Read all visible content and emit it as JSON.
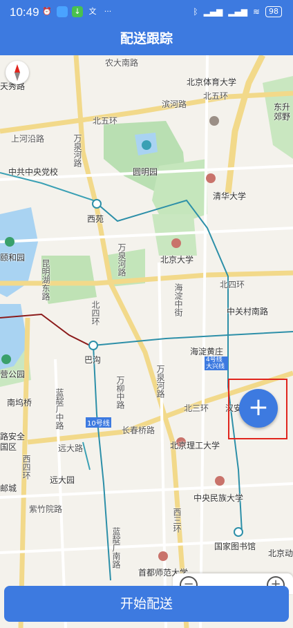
{
  "status": {
    "time": "10:49",
    "battery": "98"
  },
  "header": {
    "title": "配送跟踪"
  },
  "map": {
    "labels": [
      {
        "text": "农大南路"
      },
      {
        "text": "天秀路"
      },
      {
        "text": "北京体育大学"
      },
      {
        "text": "东升"
      },
      {
        "text": "郊野"
      },
      {
        "text": "滨河路"
      },
      {
        "text": "北五环"
      },
      {
        "text": "北五环"
      },
      {
        "text": "上河沿路"
      },
      {
        "text": "万泉河路"
      },
      {
        "text": "中共中央党校"
      },
      {
        "text": "圆明园"
      },
      {
        "text": "清华大学"
      },
      {
        "text": "西苑"
      },
      {
        "text": "颐和园"
      },
      {
        "text": "北京大学"
      },
      {
        "text": "万泉河路"
      },
      {
        "text": "昆明湖东路"
      },
      {
        "text": "海淀中街"
      },
      {
        "text": "北四环"
      },
      {
        "text": "中关村南路"
      },
      {
        "text": "北四环"
      },
      {
        "text": "巴沟"
      },
      {
        "text": "海淀黄庄"
      },
      {
        "text": "4号线 大兴线"
      },
      {
        "text": "营公园"
      },
      {
        "text": "万柳中路"
      },
      {
        "text": "万泉河路"
      },
      {
        "text": "南坞桥"
      },
      {
        "text": "蓝靛厂中路"
      },
      {
        "text": "北三环"
      },
      {
        "text": "汉安"
      },
      {
        "text": "10号线"
      },
      {
        "text": "长春桥路"
      },
      {
        "text": "路安全"
      },
      {
        "text": "国区"
      },
      {
        "text": "远大路"
      },
      {
        "text": "北京理工大学"
      },
      {
        "text": "西四环"
      },
      {
        "text": "远大园"
      },
      {
        "text": "邮城"
      },
      {
        "text": "中央民族大学"
      },
      {
        "text": "紫竹院路"
      },
      {
        "text": "西三环"
      },
      {
        "text": "蓝靛厂南路"
      },
      {
        "text": "国家图书馆"
      },
      {
        "text": "北京动"
      },
      {
        "text": "首都师范大学"
      }
    ]
  },
  "zoom": {
    "out": "−",
    "in": "+"
  },
  "fab": {
    "label": "+"
  },
  "actions": {
    "start": "开始配送"
  }
}
